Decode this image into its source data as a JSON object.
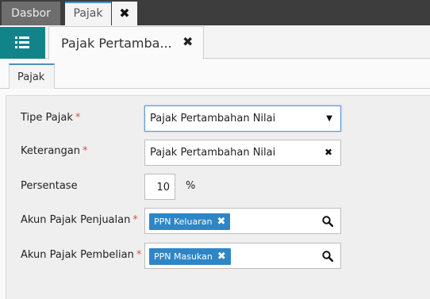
{
  "app_tabs": {
    "dasbor": "Dasbor",
    "pajak": "Pajak",
    "close_glyph": "✖"
  },
  "doc_tab": {
    "title": "Pajak Pertamba...",
    "close_glyph": "✖"
  },
  "section_tab": "Pajak",
  "form": {
    "tipe_pajak": {
      "label": "Tipe Pajak",
      "required": "*",
      "value": "Pajak Pertambahan Nilai",
      "arrow": "▼"
    },
    "keterangan": {
      "label": "Keterangan",
      "required": "*",
      "value": "Pajak Pertambahan Nilai",
      "clear": "✖"
    },
    "persentase": {
      "label": "Persentase",
      "value": "10",
      "unit": "%"
    },
    "akun_penjualan": {
      "label": "Akun Pajak Penjualan",
      "required": "*",
      "chip": "PPN Keluaran",
      "chip_x": "✖"
    },
    "akun_pembelian": {
      "label": "Akun Pajak Pembelian",
      "required": "*",
      "chip": "PPN Masukan",
      "chip_x": "✖"
    }
  },
  "colors": {
    "accent": "#13838a",
    "chip": "#2f86c6",
    "required": "#d9534f",
    "focus": "#5b9bd5"
  }
}
